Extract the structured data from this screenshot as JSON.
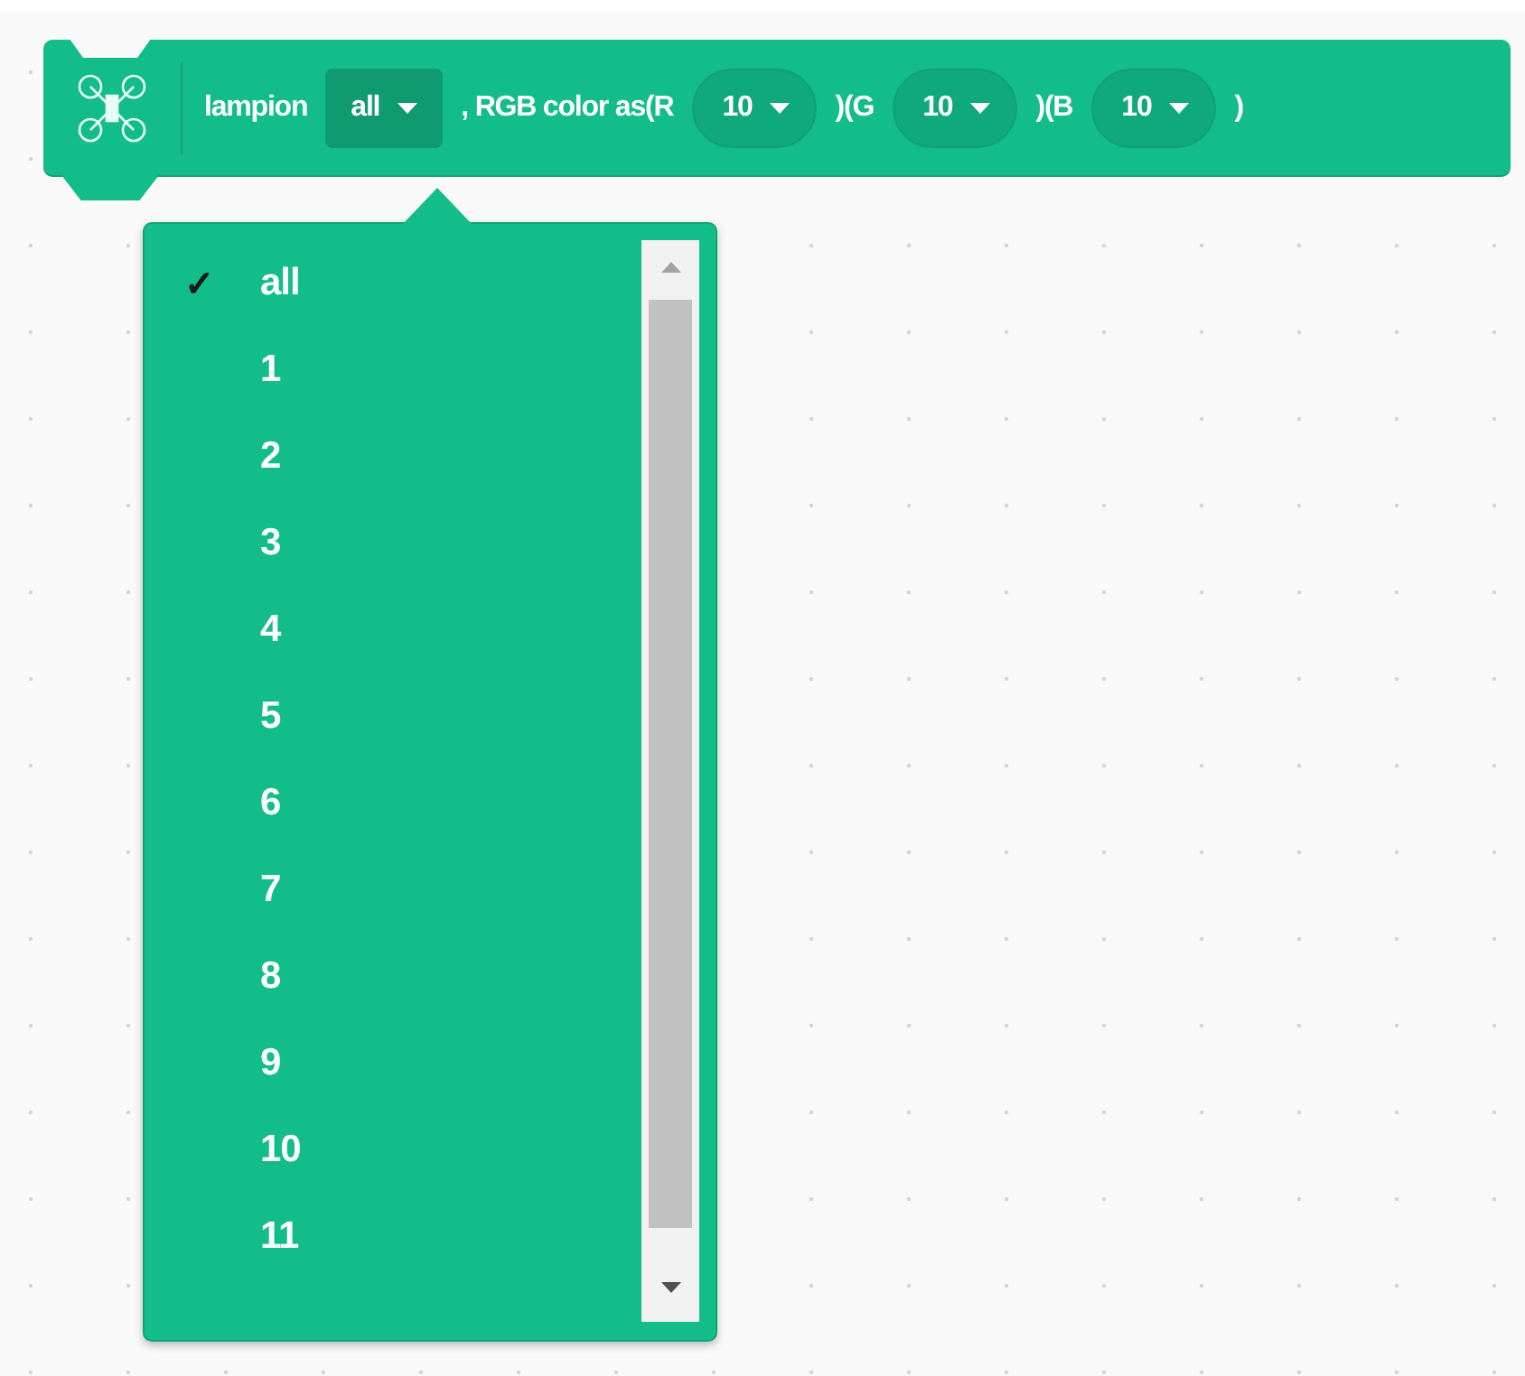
{
  "block": {
    "label": "lampion",
    "target": {
      "value": "all"
    },
    "text_after_target": ", RGB color as(R",
    "channels": [
      {
        "value": "10",
        "text_after": ")(G"
      },
      {
        "value": "10",
        "text_after": ")(B"
      },
      {
        "value": "10",
        "text_after": ")"
      }
    ]
  },
  "menu": {
    "check_mark": "✓",
    "items": [
      {
        "label": "all",
        "selected": true
      },
      {
        "label": "1",
        "selected": false
      },
      {
        "label": "2",
        "selected": false
      },
      {
        "label": "3",
        "selected": false
      },
      {
        "label": "4",
        "selected": false
      },
      {
        "label": "5",
        "selected": false
      },
      {
        "label": "6",
        "selected": false
      },
      {
        "label": "7",
        "selected": false
      },
      {
        "label": "8",
        "selected": false
      },
      {
        "label": "9",
        "selected": false
      },
      {
        "label": "10",
        "selected": false
      },
      {
        "label": "11",
        "selected": false
      }
    ]
  }
}
